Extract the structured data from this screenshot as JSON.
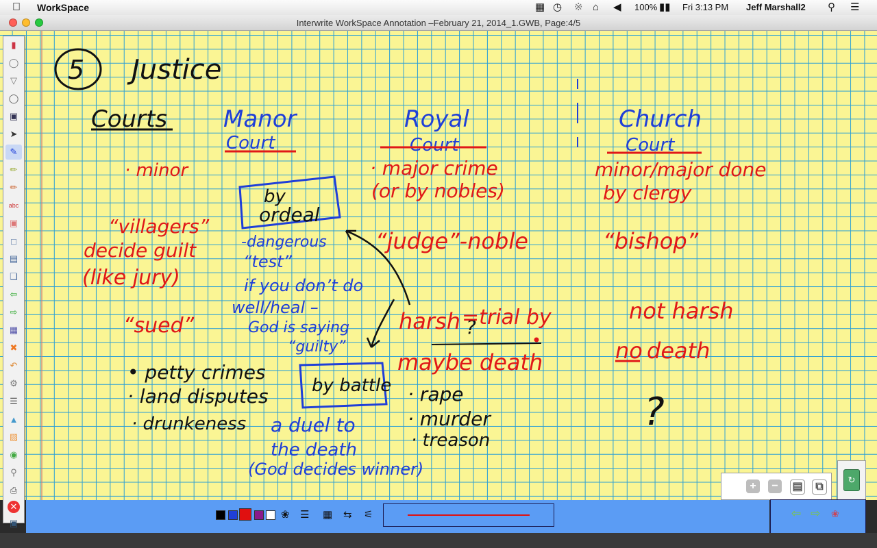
{
  "menubar": {
    "app_name": "WorkSpace",
    "battery": "100%",
    "clock": "Fri 3:13 PM",
    "user": "Jeff Marshall2",
    "icons": [
      "apple-icon",
      "dropbox-icon",
      "time-machine-icon",
      "bluetooth-icon",
      "wifi-icon",
      "volume-icon",
      "battery-icon",
      "search-icon",
      "list-icon"
    ]
  },
  "window": {
    "title": "Interwrite WorkSpace Annotation –February 21, 2014_1.GWB, Page:4/5"
  },
  "board": {
    "colors": {
      "paper": "#faf594",
      "grid": "#2a9fd6",
      "black_ink": "#111111",
      "blue_ink": "#1f3fd8",
      "red_ink": "#e01818"
    },
    "heading_number": "5",
    "heading": "Justice",
    "courts_label": "Courts",
    "manor": {
      "title": "Manor",
      "subtitle": "Court",
      "items": [
        "· minor",
        "“villagers”",
        "decide guilt",
        "(like jury)",
        "“sued”"
      ],
      "list": [
        "• petty crimes",
        "· land disputes",
        "· drunkeness"
      ],
      "ordeal_box": [
        "by",
        "ordeal"
      ],
      "ordeal_notes": [
        "-dangerous",
        "“test”",
        "if you don’t do",
        "well/heal –",
        "God is saying",
        "“guilty”"
      ],
      "battle_box": "by battle",
      "battle_notes": [
        "a duel to",
        "the death",
        "(God decides winner)"
      ]
    },
    "royal": {
      "title": "Royal",
      "subtitle": "Court",
      "items": [
        "· major crime",
        "(or by nobles)",
        "“judge”-noble",
        "harsh",
        "?",
        "=trial by",
        "maybe death"
      ],
      "list": [
        "· rape",
        "· murder",
        "· treason"
      ]
    },
    "church": {
      "title": "Church",
      "subtitle": "Court",
      "items": [
        "minor/major done",
        "by clergy",
        "“bishop”",
        "not harsh",
        "no",
        "death",
        "?"
      ]
    }
  },
  "toolbar": {
    "tools": [
      "workspace-logo-icon",
      "menu-circle-icon",
      "down-circle-icon",
      "mouse-icon",
      "save-icon",
      "pointer-icon",
      "pen-icon",
      "highlighter-icon",
      "pencil-icon",
      "spell-text-icon",
      "eraser-icon",
      "blank-page-icon",
      "lined-page-icon",
      "copy-page-icon",
      "previous-page-icon",
      "next-page-icon",
      "page-sorter-icon",
      "close-tool-icon",
      "undo-icon",
      "gear-tool-icon",
      "ruler-icon",
      "shapes-icon",
      "clip-icon",
      "spotlight-icon",
      "flashlight-icon",
      "printer-icon",
      "exit-icon",
      "screenshot-icon"
    ]
  },
  "palette": {
    "colors": [
      "#000000",
      "#1f3fd8",
      "#e01010",
      "#8a1a8a",
      "#ffffff"
    ],
    "selected_color": "#e01010",
    "tools": [
      "palette-icon",
      "line-width-icon",
      "fill-icon",
      "arrow-style-icon",
      "line-style-icon"
    ]
  },
  "zoom": {
    "buttons": [
      {
        "label": "+",
        "name": "zoom-in-button"
      },
      {
        "label": "−",
        "name": "zoom-out-button"
      },
      {
        "label": "▤",
        "name": "page-view-button"
      },
      {
        "label": "⧉",
        "name": "duplicate-button"
      }
    ]
  },
  "nav": {
    "prev": "⇦",
    "next": "⇨",
    "extra": "❀"
  }
}
